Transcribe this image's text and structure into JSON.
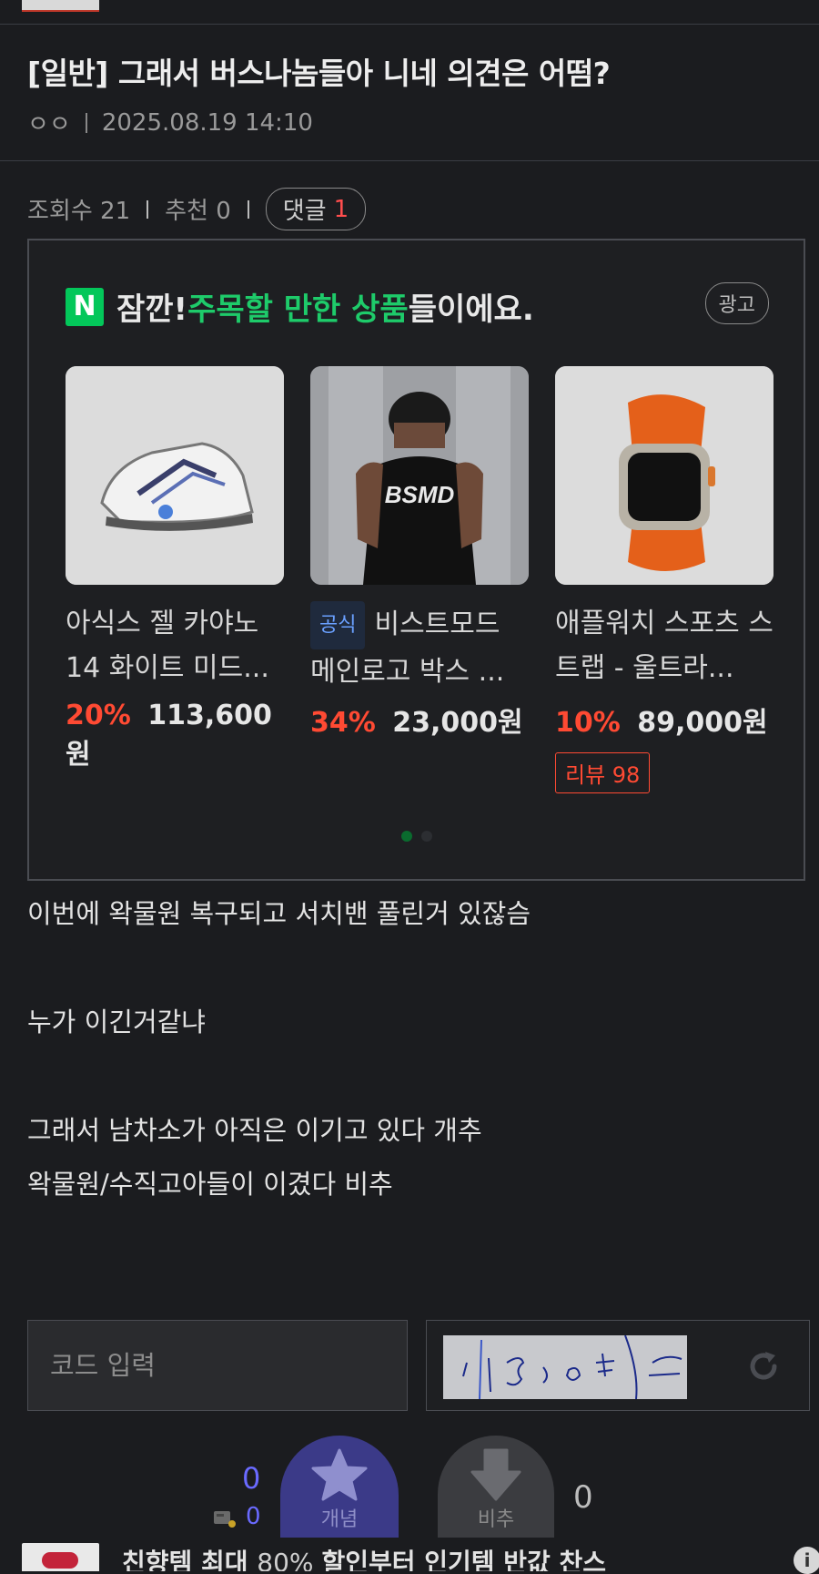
{
  "post": {
    "title": "[일반] 그래서 버스나놈들아 니네 의견은 어떰?",
    "author": "ㅇㅇ",
    "datetime": "2025.08.19 14:10",
    "views_label": "조회수 21",
    "recommend_label": "추천 0",
    "comments_label": "댓글",
    "comments_count": "1"
  },
  "ad": {
    "logo": "N",
    "headline_pre": "잠깐! ",
    "headline_highlight": "주목할 만한 상품",
    "headline_post": "들이에요.",
    "badge": "광고",
    "products": [
      {
        "name": "아식스 젤 카야노 14 화이트 미드...",
        "discount": "20%",
        "price": "113,600원"
      },
      {
        "official_tag": "공식",
        "name": "비스트모드 메인로고 박스 ...",
        "discount": "34%",
        "price": "23,000원"
      },
      {
        "name": "애플워치 스포츠 스트랩 - 울트라...",
        "discount": "10%",
        "price": "89,000원",
        "review": "리뷰 98"
      }
    ],
    "page_count": 2,
    "page_index": 1
  },
  "body": {
    "lines": [
      "이번에 왁물원 복구되고 서치밴 풀린거 있잖슴",
      "누가 이긴거같냐",
      "그래서 남차소가 아직은 이기고 있다 개추",
      "왁물원/수직고아들이 이겼다 비추"
    ]
  },
  "captcha": {
    "placeholder": "코드 입력"
  },
  "vote": {
    "up_count": "0",
    "fixed_count": "0",
    "up_label": "개념",
    "down_label": "비추",
    "down_count": "0"
  },
  "bottom_banner": {
    "text_bold_1": "친향템 최대 ",
    "text_thin": "80% ",
    "text_bold_2": "할인부터 인기템 반값 찬스"
  },
  "colors": {
    "background": "#1b1c1f",
    "naver_green": "#03c75a",
    "discount_red": "#ff4a33",
    "vote_up": "#3b3a88",
    "count_blue": "#6a6aff"
  }
}
